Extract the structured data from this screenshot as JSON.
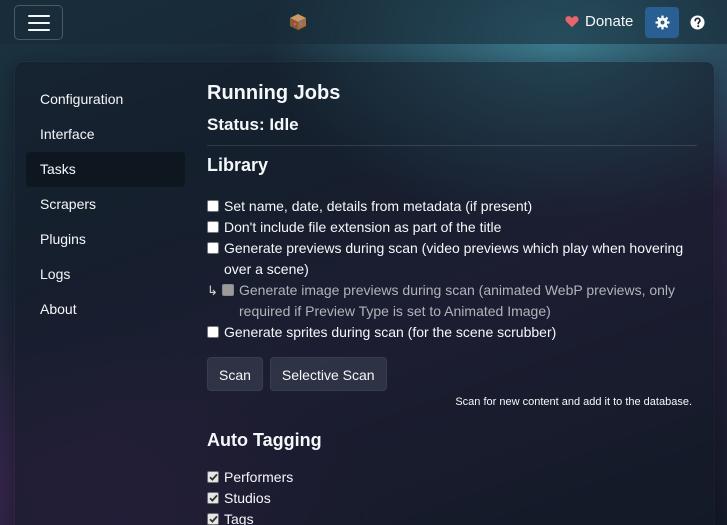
{
  "navbar": {
    "donate_label": "Donate",
    "icons": [
      "menu-icon",
      "box-logo-icon",
      "heart-icon",
      "gear-icon",
      "question-circle-icon"
    ]
  },
  "sidebar": {
    "items": [
      {
        "label": "Configuration",
        "active": false
      },
      {
        "label": "Interface",
        "active": false
      },
      {
        "label": "Tasks",
        "active": true
      },
      {
        "label": "Scrapers",
        "active": false
      },
      {
        "label": "Plugins",
        "active": false
      },
      {
        "label": "Logs",
        "active": false
      },
      {
        "label": "About",
        "active": false
      }
    ]
  },
  "running_jobs": {
    "title": "Running Jobs",
    "status": "Status: Idle"
  },
  "library": {
    "title": "Library",
    "options": [
      {
        "label": "Set name, date, details from metadata (if present)",
        "checked": false
      },
      {
        "label": "Don't include file extension as part of the title",
        "checked": false
      },
      {
        "label": "Generate previews during scan (video previews which play when hovering over a scene)",
        "checked": false
      },
      {
        "label": "Generate image previews during scan (animated WebP previews, only required if Preview Type is set to Animated Image)",
        "checked": false,
        "disabled": true,
        "sub_marker": "↳"
      },
      {
        "label": "Generate sprites during scan (for the scene scrubber)",
        "checked": false
      }
    ],
    "scan_button": "Scan",
    "selective_scan_button": "Selective Scan",
    "scan_hint": "Scan for new content and add it to the database."
  },
  "auto_tagging": {
    "title": "Auto Tagging",
    "options": [
      {
        "label": "Performers",
        "checked": true
      },
      {
        "label": "Studios",
        "checked": true
      },
      {
        "label": "Tags",
        "checked": true
      }
    ]
  },
  "colors": {
    "accent": "#2a5f93",
    "heart": "#e8656e",
    "text": "#f5f8fa"
  }
}
